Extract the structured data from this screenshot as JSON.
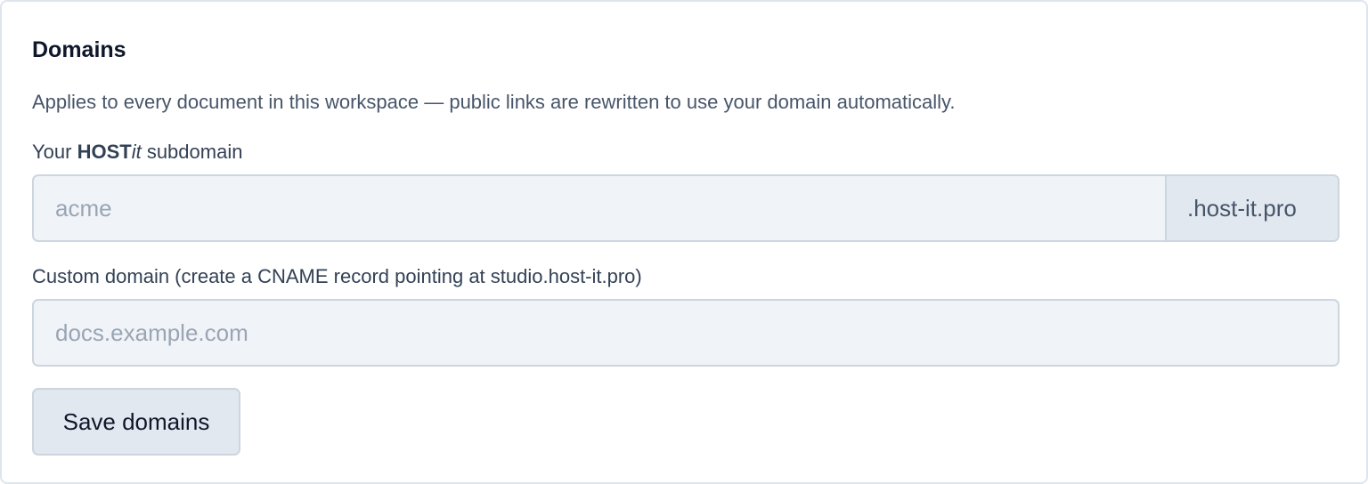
{
  "section": {
    "title": "Domains",
    "description": "Applies to every document in this workspace — public links are rewritten to use your domain automatically."
  },
  "subdomain": {
    "label_prefix": "Your ",
    "label_brand_bold": "HOST",
    "label_brand_italic": "it",
    "label_suffix": " subdomain",
    "placeholder": "acme",
    "value": "",
    "suffix": ".host-it.pro"
  },
  "custom_domain": {
    "label": "Custom domain (create a CNAME record pointing at studio.host-it.pro)",
    "placeholder": "docs.example.com",
    "value": ""
  },
  "actions": {
    "save_label": "Save domains"
  }
}
